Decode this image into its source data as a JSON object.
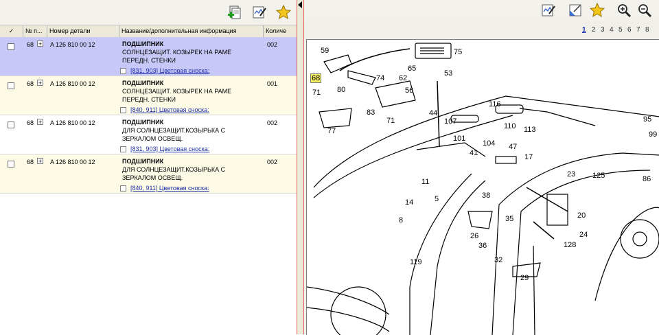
{
  "table": {
    "headers": {
      "check": "✓",
      "pos": "№ п...",
      "part_number": "Номер детали",
      "name": "Название/дополнительная информация",
      "qty": "Количе"
    },
    "rows": [
      {
        "pos": "68",
        "part": "A 126 810 00 12",
        "name": "ПОДШИПНИК",
        "desc1": "СОЛНЦЕЗАЩИТ. КОЗЫРЕК НА РАМЕ",
        "desc2": "ПЕРЕДН. СТЕНКИ",
        "footnote": "[831, 903] Цветовая сноска:",
        "qty": "002"
      },
      {
        "pos": "68",
        "part": "A 126 810 00 12",
        "name": "ПОДШИПНИК",
        "desc1": "СОЛНЦЕЗАЩИТ. КОЗЫРЕК НА РАМЕ",
        "desc2": "ПЕРЕДН. СТЕНКИ",
        "footnote": "[840, 911] Цветовая сноска:",
        "qty": "001"
      },
      {
        "pos": "68",
        "part": "A 126 810 00 12",
        "name": "ПОДШИПНИК",
        "desc1": "ДЛЯ СОЛНЦЕЗАЩИТ.КОЗЫРЬКА С",
        "desc2": "ЗЕРКАЛОМ ОСВЕЩ.",
        "footnote": "[831, 903] Цветовая сноска:",
        "qty": "002"
      },
      {
        "pos": "68",
        "part": "A 126 810 00 12",
        "name": "ПОДШИПНИК",
        "desc1": "ДЛЯ СОЛНЦЕЗАЩИТ.КОЗЫРЬКА С",
        "desc2": "ЗЕРКАЛОМ ОСВЕЩ.",
        "footnote": "[840, 911] Цветовая сноска:",
        "qty": "002"
      }
    ]
  },
  "pager": {
    "pages": [
      "1",
      "2",
      "3",
      "4",
      "5",
      "6",
      "7",
      "8"
    ],
    "current": "1"
  },
  "diagram": {
    "callouts": [
      "59",
      "75",
      "65",
      "62",
      "74",
      "53",
      "56",
      "68",
      "71",
      "80",
      "44",
      "83",
      "77",
      "71",
      "107",
      "116",
      "110",
      "113",
      "101",
      "104",
      "41",
      "47",
      "95",
      "99",
      "17",
      "11",
      "23",
      "125",
      "86",
      "5",
      "14",
      "38",
      "20",
      "8",
      "35",
      "26",
      "24",
      "36",
      "128",
      "119",
      "32",
      "29"
    ],
    "highlighted": "68"
  },
  "colors": {
    "selected_row": "#c8c8f8",
    "alt_row": "#fdfbe6",
    "link": "#1c2fa8",
    "highlight": "#f4ee60"
  }
}
